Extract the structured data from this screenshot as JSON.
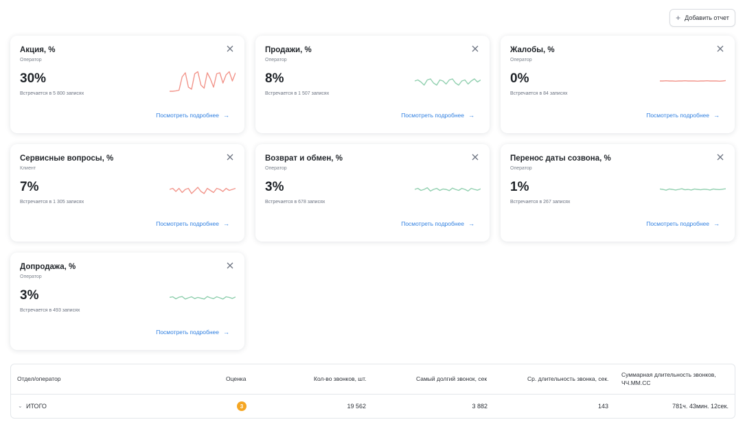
{
  "toolbar": {
    "add_report_label": "Добавить отчет",
    "add_icon": "plus-icon"
  },
  "cards": [
    {
      "title": "Акция, %",
      "subtitle": "Оператор",
      "value": "30%",
      "records": "Встречается в 5 800 записях",
      "link": "Посмотреть подробнее",
      "trend_color": "#f2948a",
      "trend": [
        0.0,
        0.0,
        0.02,
        0.05,
        0.7,
        0.9,
        0.2,
        0.1,
        0.85,
        0.95,
        0.3,
        0.15,
        0.9,
        0.6,
        0.2,
        0.85,
        0.9,
        0.4,
        0.8,
        0.95,
        0.5,
        0.9
      ]
    },
    {
      "title": "Продажи, %",
      "subtitle": "Оператор",
      "value": "8%",
      "records": "Встречается в 1 507 записях",
      "link": "Посмотреть подробнее",
      "trend_color": "#8fcfae",
      "trend": [
        0.5,
        0.55,
        0.45,
        0.3,
        0.55,
        0.6,
        0.4,
        0.3,
        0.55,
        0.5,
        0.35,
        0.55,
        0.6,
        0.4,
        0.3,
        0.5,
        0.55,
        0.35,
        0.5,
        0.6,
        0.45,
        0.55
      ]
    },
    {
      "title": "Жалобы, %",
      "subtitle": "Оператор",
      "value": "0%",
      "records": "Встречается в 84 записях",
      "link": "Посмотреть подробнее",
      "trend_color": "#f2948a",
      "trend": [
        0.5,
        0.5,
        0.51,
        0.5,
        0.5,
        0.49,
        0.5,
        0.5,
        0.51,
        0.5,
        0.5,
        0.5,
        0.49,
        0.5,
        0.5,
        0.51,
        0.5,
        0.5,
        0.5,
        0.49,
        0.5,
        0.52
      ]
    },
    {
      "title": "Сервисные вопросы, %",
      "subtitle": "Клиент",
      "value": "7%",
      "records": "Встречается в 1 305 записях",
      "link": "Посмотреть подробнее",
      "trend_color": "#f2948a",
      "trend": [
        0.5,
        0.55,
        0.4,
        0.55,
        0.35,
        0.5,
        0.55,
        0.3,
        0.45,
        0.6,
        0.4,
        0.3,
        0.55,
        0.45,
        0.35,
        0.55,
        0.5,
        0.4,
        0.55,
        0.45,
        0.5,
        0.55
      ]
    },
    {
      "title": "Возврат и обмен, %",
      "subtitle": "Оператор",
      "value": "3%",
      "records": "Встречается в 678 записях",
      "link": "Посмотреть подробнее",
      "trend_color": "#8fcfae",
      "trend": [
        0.5,
        0.55,
        0.45,
        0.5,
        0.58,
        0.42,
        0.5,
        0.55,
        0.45,
        0.52,
        0.5,
        0.44,
        0.56,
        0.5,
        0.45,
        0.55,
        0.5,
        0.42,
        0.55,
        0.5,
        0.46,
        0.53
      ]
    },
    {
      "title": "Перенос даты созвона, %",
      "subtitle": "Оператор",
      "value": "1%",
      "records": "Встречается в 267 записях",
      "link": "Посмотреть подробнее",
      "trend_color": "#8fcfae",
      "trend": [
        0.52,
        0.5,
        0.46,
        0.52,
        0.5,
        0.47,
        0.5,
        0.53,
        0.48,
        0.5,
        0.47,
        0.52,
        0.5,
        0.48,
        0.51,
        0.5,
        0.47,
        0.52,
        0.5,
        0.49,
        0.51,
        0.53
      ]
    },
    {
      "title": "Допродажа, %",
      "subtitle": "Оператор",
      "value": "3%",
      "records": "Встречается в 493 записях",
      "link": "Посмотреть подробнее",
      "trend_color": "#8fcfae",
      "trend": [
        0.52,
        0.55,
        0.45,
        0.53,
        0.56,
        0.44,
        0.5,
        0.55,
        0.46,
        0.52,
        0.48,
        0.44,
        0.56,
        0.5,
        0.46,
        0.55,
        0.5,
        0.44,
        0.55,
        0.52,
        0.47,
        0.54
      ]
    }
  ],
  "table": {
    "headers": {
      "department": "Отдел/оператор",
      "score": "Оценка",
      "calls_count": "Кол-во звонков, шт.",
      "longest_call": "Самый долгий звонок, сек",
      "avg_duration": "Ср. длительность звонка, сек.",
      "total_duration": "Суммарная длительность звонков, ЧЧ.ММ.СС"
    },
    "total_row": {
      "label": "ИТОГО",
      "score": "3",
      "score_color": "#f5a623",
      "calls_count": "19 562",
      "longest_call": "3 882",
      "avg_duration": "143",
      "total_duration": "781ч. 43мин. 12сек."
    }
  }
}
